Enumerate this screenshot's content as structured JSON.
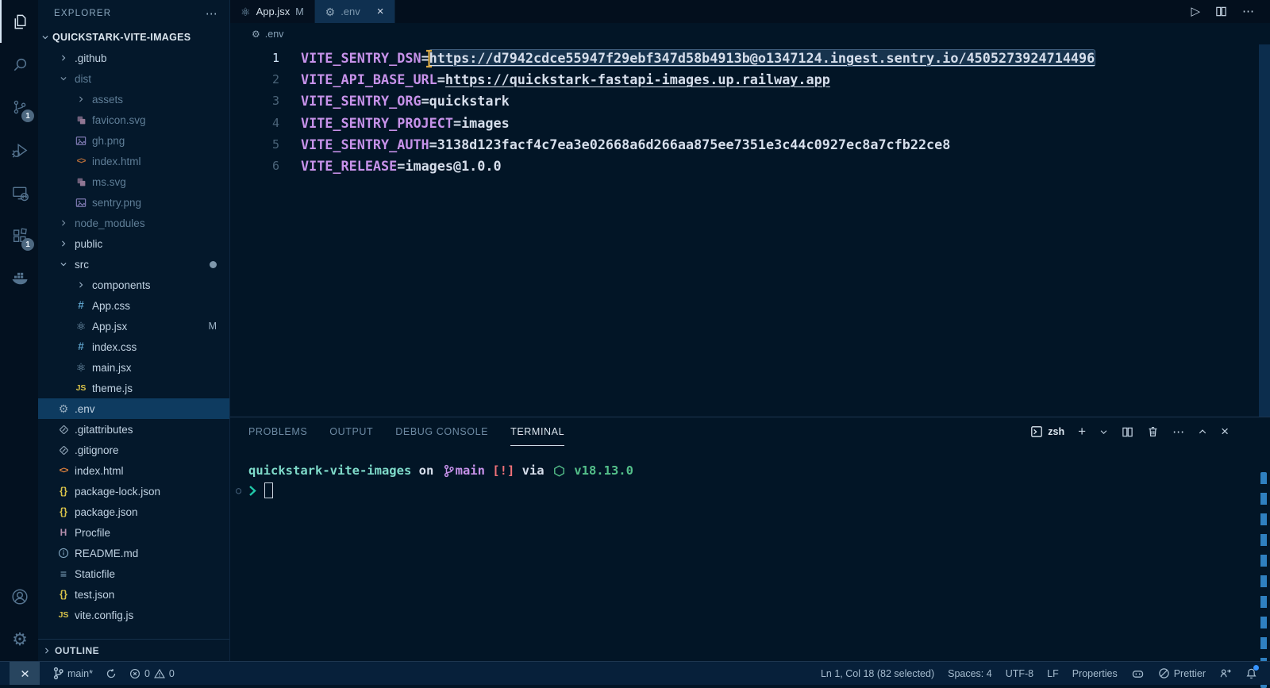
{
  "colors": {
    "editor_background": "#021526",
    "sidebar_background": "#04182b",
    "active_tab_background": "#0f3050",
    "key_purple": "#c792ea",
    "text": "#d6deeb",
    "dim_text": "#5f7e97",
    "selection_blue": "#3e6c99",
    "prompt_teal": "#7fdbca",
    "prompt_magenta": "#c792ea",
    "prompt_red": "#f07178",
    "prompt_green": "#54c08a",
    "status_remote_background": "#28455f",
    "notification_dot": "#3794ff"
  },
  "activity_bar": {
    "items": [
      {
        "name": "explorer",
        "active": true
      },
      {
        "name": "search"
      },
      {
        "name": "source-control",
        "badge": "1"
      },
      {
        "name": "run-debug"
      },
      {
        "name": "remote-explorer"
      },
      {
        "name": "extensions",
        "badge": "1"
      },
      {
        "name": "docker"
      }
    ],
    "bottom": [
      {
        "name": "accounts"
      },
      {
        "name": "settings"
      }
    ]
  },
  "sidebar": {
    "title": "EXPLORER",
    "root": {
      "label": "QUICKSTARK-VITE-IMAGES"
    },
    "items": [
      {
        "label": ".github",
        "depth": 1,
        "chevron": "right"
      },
      {
        "label": "dist",
        "depth": 1,
        "chevron": "down",
        "dim": true
      },
      {
        "label": "assets",
        "depth": 2,
        "chevron": "right",
        "dim": true
      },
      {
        "label": "favicon.svg",
        "depth": 2,
        "icon": "svg-file",
        "dim": true
      },
      {
        "label": "gh.png",
        "depth": 2,
        "icon": "image",
        "dim": true
      },
      {
        "label": "index.html",
        "depth": 2,
        "icon": "html",
        "dim": true
      },
      {
        "label": "ms.svg",
        "depth": 2,
        "icon": "svg-file",
        "dim": true
      },
      {
        "label": "sentry.png",
        "depth": 2,
        "icon": "image",
        "dim": true
      },
      {
        "label": "node_modules",
        "depth": 1,
        "chevron": "right",
        "dim": true
      },
      {
        "label": "public",
        "depth": 1,
        "chevron": "right"
      },
      {
        "label": "src",
        "depth": 1,
        "chevron": "down",
        "mod_dot": true
      },
      {
        "label": "components",
        "depth": 2,
        "chevron": "right"
      },
      {
        "label": "App.css",
        "depth": 2,
        "icon": "css"
      },
      {
        "label": "App.jsx",
        "depth": 2,
        "icon": "react",
        "git_badge": "M"
      },
      {
        "label": "index.css",
        "depth": 2,
        "icon": "css"
      },
      {
        "label": "main.jsx",
        "depth": 2,
        "icon": "react"
      },
      {
        "label": "theme.js",
        "depth": 2,
        "icon": "js"
      },
      {
        "label": ".env",
        "depth": 1,
        "icon": "gear",
        "selected": true
      },
      {
        "label": ".gitattributes",
        "depth": 1,
        "icon": "git"
      },
      {
        "label": ".gitignore",
        "depth": 1,
        "icon": "git"
      },
      {
        "label": "index.html",
        "depth": 1,
        "icon": "html"
      },
      {
        "label": "package-lock.json",
        "depth": 1,
        "icon": "json"
      },
      {
        "label": "package.json",
        "depth": 1,
        "icon": "json"
      },
      {
        "label": "Procfile",
        "depth": 1,
        "icon": "heroku"
      },
      {
        "label": "README.md",
        "depth": 1,
        "icon": "info"
      },
      {
        "label": "Staticfile",
        "depth": 1,
        "icon": "lines"
      },
      {
        "label": "test.json",
        "depth": 1,
        "icon": "json"
      },
      {
        "label": "vite.config.js",
        "depth": 1,
        "icon": "js"
      }
    ],
    "outline": {
      "label": "OUTLINE"
    }
  },
  "editor_tabs": [
    {
      "label": "App.jsx",
      "icon": "react",
      "badge": "M",
      "active": false
    },
    {
      "label": ".env",
      "icon": "gear",
      "active": true,
      "closable": true
    }
  ],
  "breadcrumb": {
    "label": ".env"
  },
  "editor": {
    "lines": [
      {
        "num": "1",
        "key": "VITE_SENTRY_DSN",
        "value": "https://d7942cdce55947f29ebf347d58b4913b@o1347124.ingest.sentry.io/4505273924714496",
        "url": true,
        "selected": true,
        "active": true
      },
      {
        "num": "2",
        "key": "VITE_API_BASE_URL",
        "value": "https://quickstark-fastapi-images.up.railway.app",
        "url": true
      },
      {
        "num": "3",
        "key": "VITE_SENTRY_ORG",
        "value": "quickstark"
      },
      {
        "num": "4",
        "key": "VITE_SENTRY_PROJECT",
        "value": "images"
      },
      {
        "num": "5",
        "key": "VITE_SENTRY_AUTH",
        "value": "3138d123facf4c7ea3e02668a6d266aa875ee7351e3c44c0927ec8a7cfb22ce8"
      },
      {
        "num": "6",
        "key": "VITE_RELEASE",
        "value": "images@1.0.0"
      }
    ]
  },
  "panel": {
    "tabs": [
      {
        "label": "PROBLEMS"
      },
      {
        "label": "OUTPUT"
      },
      {
        "label": "DEBUG CONSOLE"
      },
      {
        "label": "TERMINAL",
        "active": true
      }
    ],
    "toolbar": {
      "shell_label": "zsh"
    },
    "terminal": {
      "prompt": [
        {
          "text": "quickstark-vite-images",
          "color": "#7fdbca",
          "bold": true
        },
        {
          "text": " on ",
          "color": "#d6deeb"
        },
        {
          "icon": "git-branch",
          "color": "#c792ea"
        },
        {
          "text": "main",
          "color": "#c792ea",
          "bold": true
        },
        {
          "text": " [!]",
          "color": "#f07178",
          "bold": true
        },
        {
          "text": " via ",
          "color": "#d6deeb"
        },
        {
          "icon": "node-hexagon",
          "color": "#54c08a"
        },
        {
          "text": " v18.13.0",
          "color": "#54c08a",
          "bold": true
        }
      ]
    }
  },
  "status_bar": {
    "left": [
      {
        "name": "remote-indicator"
      },
      {
        "name": "git-branch",
        "label": "main*"
      },
      {
        "name": "sync"
      },
      {
        "name": "problems",
        "errors": "0",
        "warnings": "0"
      }
    ],
    "right": [
      {
        "name": "cursor-position",
        "label": "Ln 1, Col 18 (82 selected)"
      },
      {
        "name": "indentation",
        "label": "Spaces: 4"
      },
      {
        "name": "encoding",
        "label": "UTF-8"
      },
      {
        "name": "eol",
        "label": "LF"
      },
      {
        "name": "language-mode",
        "label": "Properties"
      },
      {
        "name": "copilot"
      },
      {
        "name": "formatter",
        "label": "Prettier"
      },
      {
        "name": "feedback"
      },
      {
        "name": "notifications"
      }
    ]
  }
}
